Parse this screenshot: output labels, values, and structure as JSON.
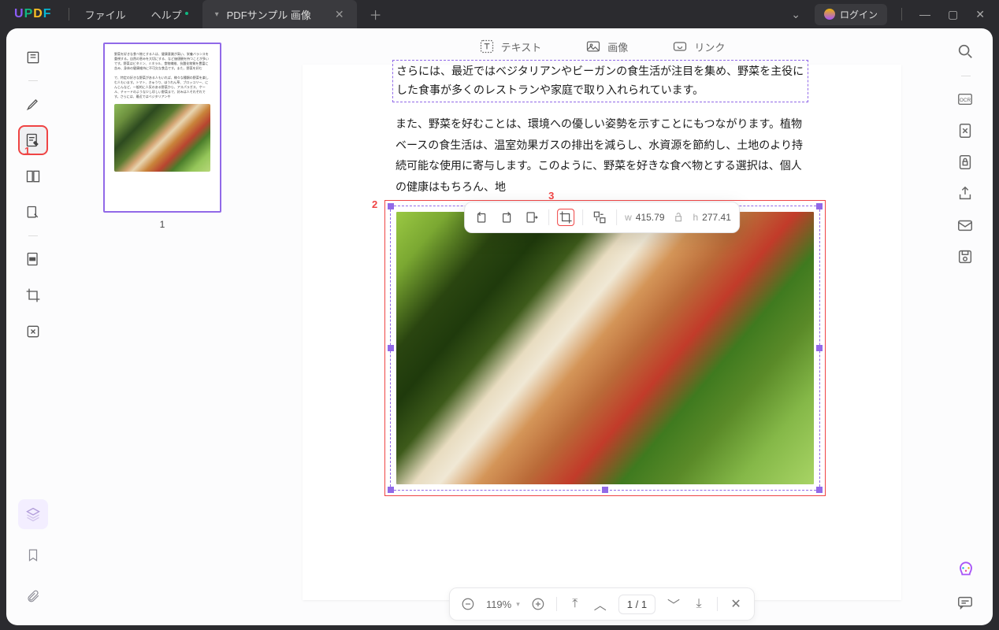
{
  "menu": {
    "file": "ファイル",
    "help": "ヘルプ"
  },
  "tab": {
    "title": "PDFサンプル 画像"
  },
  "login": {
    "label": "ログイン"
  },
  "doc_toolbar": {
    "text": "テキスト",
    "image": "画像",
    "link": "リンク"
  },
  "paragraph1": "さらには、最近ではベジタリアンやビーガンの食生活が注目を集め、野菜を主役にした食事が多くのレストランや家庭で取り入れられています。",
  "paragraph2": "また、野菜を好むことは、環境への優しい姿勢を示すことにもつながります。植物ベースの食生活は、温室効果ガスの排出を減らし、水資源を節約し、土地のより持続可能な使用に寄与します。このように、野菜を好きな食べ物とする選択は、個人の健康はもちろん、地",
  "image_toolbar": {
    "w_label": "w",
    "w_value": "415.79",
    "h_label": "h",
    "h_value": "277.41"
  },
  "thumbnail": {
    "page_number": "1"
  },
  "bottom": {
    "zoom": "119%",
    "page": "1 / 1"
  },
  "annotations": {
    "n1": "1",
    "n2": "2",
    "n3": "3"
  }
}
